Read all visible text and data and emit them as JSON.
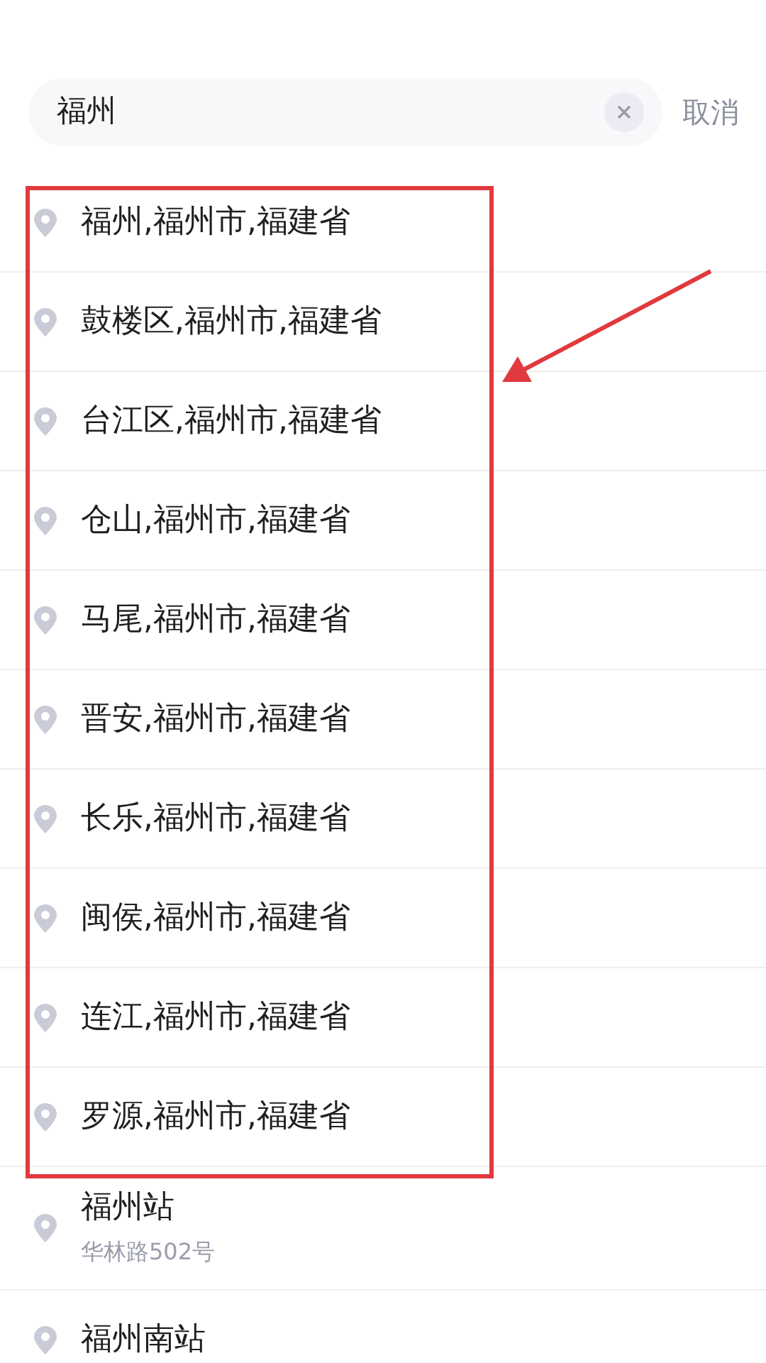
{
  "search": {
    "value": "福州",
    "cancel": "取消"
  },
  "results": [
    {
      "title": "福州,福州市,福建省"
    },
    {
      "title": "鼓楼区,福州市,福建省"
    },
    {
      "title": "台江区,福州市,福建省"
    },
    {
      "title": "仓山,福州市,福建省"
    },
    {
      "title": "马尾,福州市,福建省"
    },
    {
      "title": "晋安,福州市,福建省"
    },
    {
      "title": "长乐,福州市,福建省"
    },
    {
      "title": "闽侯,福州市,福建省"
    },
    {
      "title": "连江,福州市,福建省"
    },
    {
      "title": "罗源,福州市,福建省"
    },
    {
      "title": "福州站",
      "address": "华林路502号"
    },
    {
      "title": "福州南站"
    }
  ]
}
